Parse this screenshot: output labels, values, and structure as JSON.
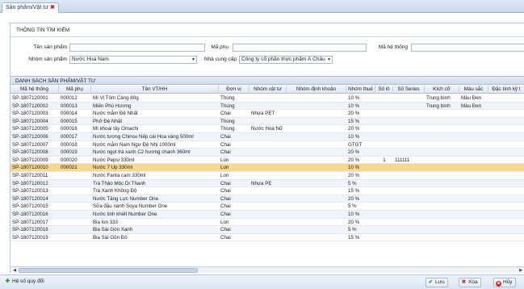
{
  "tab": {
    "title": "Sản phẩm/Vật tư"
  },
  "search": {
    "title": "THÔNG TIN TÌM KIẾM",
    "product_name_label": "Tên sản phẩm",
    "product_name_value": "",
    "sub_code_label": "Mã phụ",
    "sub_code_value": "",
    "system_code_label": "Mã hệ thống",
    "system_code_value": "",
    "product_group_label": "Nhóm sản phẩm",
    "product_group_value": "Nước Hoa Nam",
    "supplier_label": "Nhà cung cấp",
    "supplier_value": "Công ty cổ phần thực phẩm Á Châu"
  },
  "grid": {
    "title": "DANH SÁCH SẢN PHẨM/VẬT TƯ",
    "columns": [
      "Mã hệ thống",
      "Mã phụ",
      "Tên VT/HH",
      "Đơn vị",
      "Nhóm vật tư",
      "Nhóm định khoản",
      "Nhóm thuế",
      "Số lô",
      "Số Series",
      "Kích cỡ",
      "Màu sắc",
      "Đặc tính kỹ t"
    ],
    "rows": [
      [
        "SP-1807120001",
        "000012",
        "Mì Vị Tôm Càng 80g",
        "Thùng",
        "",
        "",
        "10 %",
        "",
        "",
        "Trung bình",
        "Màu Đen",
        ""
      ],
      [
        "SP-1807120002",
        "000013",
        "Miến Phú Hương",
        "Thùng",
        "",
        "",
        "10 %",
        "",
        "",
        "Trung bình",
        "Màu Đen",
        ""
      ],
      [
        "SP-1807120003",
        "000014",
        "Nước mắm Đệ Nhất",
        "Chai",
        "Nhựa PET",
        "",
        "20 %",
        "",
        "",
        "",
        "",
        ""
      ],
      [
        "SP-1807120004",
        "000015",
        "Phở Đệ Nhất",
        "Thùng",
        "",
        "",
        "15 %",
        "",
        "",
        "",
        "",
        ""
      ],
      [
        "SP-1807120005",
        "000016",
        "Mì khoai tây Omachi",
        "Thùng",
        "Nước Hoa Nữ",
        "",
        "20 %",
        "",
        "",
        "",
        "",
        ""
      ],
      [
        "SP-1807120006",
        "000017",
        "Nước tương Chinsu Nếp cái Hoa vàng 500ml",
        "Chai",
        "",
        "",
        "10 %",
        "",
        "",
        "",
        "",
        ""
      ],
      [
        "SP-1807120007",
        "000018",
        "Nước mắm Nam Ngư Đệ Nhị 1000ml",
        "Chai",
        "",
        "",
        "GTGT",
        "",
        "",
        "",
        "",
        ""
      ],
      [
        "SP-1807120008",
        "000019",
        "Nước ngọt trà xanh C2 hương chanh 360ml",
        "Chai",
        "",
        "",
        "20 %",
        "",
        "",
        "",
        "",
        ""
      ],
      [
        "SP-1807120009",
        "000020",
        "Nước Pepsi 330ml",
        "Lon",
        "",
        "",
        "20 %",
        "1",
        "111111",
        "",
        "",
        ""
      ],
      [
        "SP-1807120010",
        "000021",
        "Nước 7 Up 330ml",
        "Lon",
        "",
        "",
        "10 %",
        "",
        "",
        "",
        "",
        ""
      ],
      [
        "SP-1807120011",
        "",
        "Nước Fanta cam 330ml",
        "Lon",
        "",
        "",
        "20 %",
        "",
        "",
        "",
        "",
        ""
      ],
      [
        "SP-1807120012",
        "",
        "Trà Thảo Mộc Dr.Thanh",
        "Chai",
        "Nhựa PE",
        "",
        "5 %",
        "",
        "",
        "",
        "",
        ""
      ],
      [
        "SP-1807120013",
        "",
        "Trà Xanh Không Độ",
        "Chai",
        "",
        "",
        "15 %",
        "",
        "",
        "",
        "",
        ""
      ],
      [
        "SP-1807120014",
        "",
        "Nước Tăng Lực Number One",
        "Chai",
        "",
        "",
        "20 %",
        "",
        "",
        "",
        "",
        ""
      ],
      [
        "SP-1807120015",
        "",
        "Sữa đậu nành Soya Number One",
        "Chai",
        "",
        "",
        "5 %",
        "",
        "",
        "",
        "",
        ""
      ],
      [
        "SP-1807120016",
        "",
        "Nước tinh khiết Number One",
        "Chai",
        "",
        "",
        "10 %",
        "",
        "",
        "",
        "",
        ""
      ],
      [
        "SP-1807120017",
        "",
        "Bia lon 333",
        "Lon",
        "",
        "",
        "20 %",
        "",
        "",
        "",
        "",
        ""
      ],
      [
        "SP-1807120018",
        "",
        "Bia Sài Gòn Xanh",
        "Chai",
        "",
        "",
        "5 %",
        "",
        "",
        "",
        "",
        ""
      ],
      [
        "SP-1807120019",
        "",
        "Bia Sài Gòn Đỏ",
        "Chai",
        "",
        "",
        "15 %",
        "",
        "",
        "",
        "",
        ""
      ]
    ],
    "selected_row": 9
  },
  "footer": {
    "history_label": "Hệ số quy đổi",
    "save_label": "Lưu",
    "delete_label": "Xóa",
    "cancel_label": "Hủy"
  },
  "colors": {
    "accent": "#1a3b6b",
    "selected_row": "#f8d98b",
    "grid_border": "#a9bcd6"
  }
}
